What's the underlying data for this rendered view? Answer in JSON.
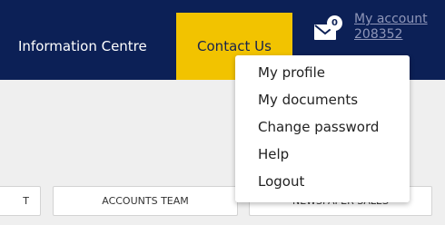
{
  "nav": {
    "information_centre": "Information Centre",
    "contact_us": "Contact Us",
    "mail_badge_count": "0",
    "my_account_label": "My account",
    "account_number": "208352"
  },
  "buttons": {
    "first_partial": "T",
    "accounts_team": "ACCOUNTS TEAM",
    "newspaper_sales": "NEWSPAPER SALES"
  },
  "dropdown": {
    "items": [
      "My profile",
      "My documents",
      "Change password",
      "Help",
      "Logout"
    ]
  },
  "colors": {
    "navbar": "#0c2056",
    "active_tab": "#f2c300",
    "background": "#efefef"
  },
  "icons": {
    "mail": "envelope-icon"
  }
}
